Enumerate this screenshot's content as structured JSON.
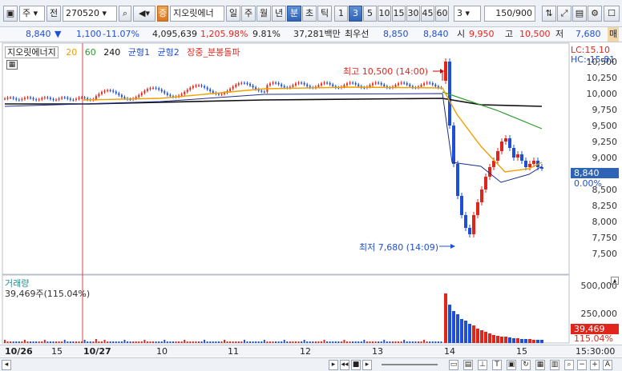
{
  "toolbar": {
    "market_label": "주",
    "prev_label": "전",
    "code": "270520",
    "stock_name": "지오릿에너",
    "tag_label": "증",
    "period_buttons": [
      "일",
      "주",
      "월",
      "년",
      "분",
      "초",
      "틱"
    ],
    "active_period": "분",
    "interval_buttons": [
      "1",
      "3",
      "5",
      "10",
      "15",
      "30",
      "45",
      "60"
    ],
    "active_interval": "3",
    "interval_value": "3",
    "count_value": "150",
    "count_total": "/900"
  },
  "quote": {
    "price": "8,840",
    "change": "1,100",
    "change_rate": "-11.07%",
    "volume": "4,095,639",
    "volume_rate": "1,205.98%",
    "turnover": "9.81%",
    "amount": "37,281백만",
    "best_ask_label": "최우선",
    "best_ask": "8,850",
    "best_bid": "8,840",
    "open_label": "시",
    "open": "9,950",
    "high_label": "고",
    "high": "10,500",
    "low_label": "저",
    "low": "7,680",
    "side_label": "매"
  },
  "legend": {
    "name": "지오릿에너지",
    "ma": [
      "20",
      "60",
      "240"
    ],
    "bal1": "균형1",
    "bal2": "균형2",
    "signal": "장중_분봉돌파"
  },
  "annotations": {
    "high": "최고 10,500 (14:00)",
    "low": "최저 7,680 (14:09)",
    "lc": "LC:15.10",
    "hc": "HC:-15.81"
  },
  "price_axis": [
    "10,500",
    "10,250",
    "10,000",
    "9,750",
    "9,500",
    "9,250",
    "9,000",
    "8,750",
    "8,500",
    "8,250",
    "8,000",
    "7,750",
    "7,500"
  ],
  "price_tags": {
    "current": "8,840",
    "pct": "0.00%"
  },
  "volume_panel": {
    "title": "거래량",
    "value": "39,469주(115.04%)",
    "axis": [
      "500,000",
      "250,000"
    ],
    "tag_value": "39,469",
    "tag_pct": "115.04%"
  },
  "dates": [
    "10/26",
    "15",
    "10/27",
    "10",
    "11",
    "12",
    "13",
    "14",
    "15"
  ],
  "time_label": "15:30:00",
  "colors": {
    "up": "#e0261c",
    "down": "#1f4fd8",
    "ma20": "#f0a000",
    "ma60": "#2b9b2b",
    "ma240": "#111111"
  }
}
